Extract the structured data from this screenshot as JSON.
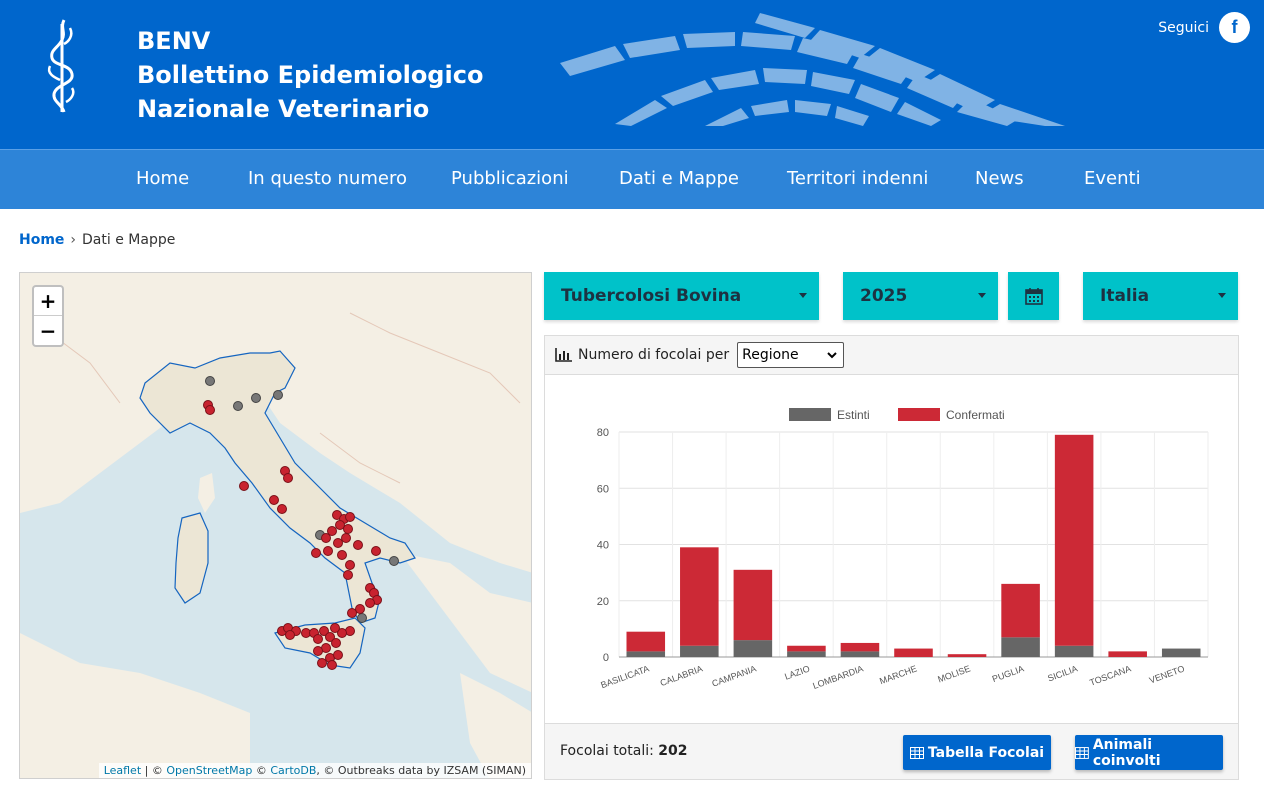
{
  "header": {
    "logo_icon": "caduceus-icon",
    "brand_line1": "BENV",
    "brand_line2": "Bollettino Epidemiologico",
    "brand_line3": "Nazionale Veterinario",
    "social_label": "Seguici",
    "facebook_icon": "f"
  },
  "nav": {
    "items": [
      {
        "label": "Home"
      },
      {
        "label": "In questo numero"
      },
      {
        "label": "Pubblicazioni"
      },
      {
        "label": "Dati e Mappe"
      },
      {
        "label": "Territori indenni"
      },
      {
        "label": "News"
      },
      {
        "label": "Eventi"
      }
    ]
  },
  "breadcrumb": {
    "home": "Home",
    "separator": "›",
    "current": "Dati e Mappe"
  },
  "map": {
    "zoom_in": "+",
    "zoom_out": "−",
    "attribution": {
      "leaflet": "Leaflet",
      "sep1": " | © ",
      "osm": "OpenStreetMap",
      "sep2": " © ",
      "carto": "CartoDB",
      "rest": ", © Outbreaks data by IZSAM (SIMAN)"
    }
  },
  "filters": {
    "disease": "Tubercolosi Bovina",
    "year": "2025",
    "calendar_icon": "calendar-icon",
    "area": "Italia"
  },
  "panel": {
    "chart_icon": "bar-chart-icon",
    "group_label": "Numero di focolai per",
    "group_value": "Regione",
    "total_label": "Focolai totali:",
    "total_value": "202",
    "btn_table": "Tabella Focolai",
    "btn_animals": "Animali coinvolti"
  },
  "colors": {
    "header_blue": "#0066cc",
    "nav_blue": "#2d84d8",
    "teal": "#00c2c9",
    "estinti": "#666666",
    "confermati": "#cc2936"
  },
  "chart_data": {
    "type": "bar",
    "stacked": true,
    "categories": [
      "BASILICATA",
      "CALABRIA",
      "CAMPANIA",
      "LAZIO",
      "LOMBARDIA",
      "MARCHE",
      "MOLISE",
      "PUGLIA",
      "SICILIA",
      "TOSCANA",
      "VENETO"
    ],
    "series": [
      {
        "name": "Estinti",
        "values": [
          2,
          4,
          6,
          2,
          2,
          0,
          0,
          7,
          4,
          0,
          3
        ]
      },
      {
        "name": "Confermati",
        "values": [
          7,
          35,
          25,
          2,
          3,
          3,
          1,
          19,
          75,
          2,
          0
        ]
      }
    ],
    "ylim": [
      0,
      80
    ],
    "yticks": [
      0,
      20,
      40,
      60,
      80
    ],
    "legend": "top-center",
    "grid": true
  }
}
